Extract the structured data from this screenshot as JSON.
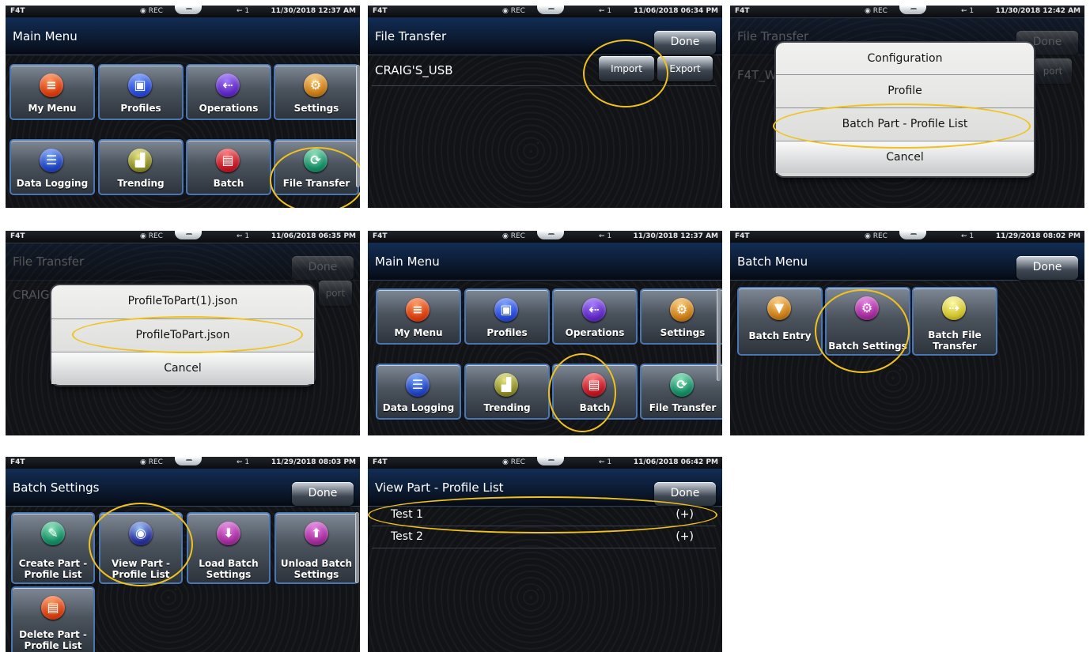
{
  "panels": [
    {
      "status": {
        "app": "F4T",
        "rec": "REC",
        "usb": "1",
        "datetime": "11/30/2018 12:37 AM"
      },
      "title": "Main Menu",
      "tiles": [
        {
          "label": "My Menu",
          "icon": "menu-icon",
          "glyph": "≡"
        },
        {
          "label": "Profiles",
          "icon": "profiles-icon",
          "glyph": "▣"
        },
        {
          "label": "Operations",
          "icon": "operations-icon",
          "glyph": "⇠"
        },
        {
          "label": "Settings",
          "icon": "settings-icon",
          "glyph": "⚙"
        },
        {
          "label": "Data Logging",
          "icon": "database-icon",
          "glyph": "☰"
        },
        {
          "label": "Trending",
          "icon": "trending-icon",
          "glyph": "▟"
        },
        {
          "label": "Batch",
          "icon": "batch-icon",
          "glyph": "▤"
        },
        {
          "label": "File Transfer",
          "icon": "file-transfer-icon",
          "glyph": "⟳"
        }
      ]
    },
    {
      "status": {
        "app": "F4T",
        "rec": "REC",
        "usb": "1",
        "datetime": "11/06/2018 06:34 PM"
      },
      "title": "File Transfer",
      "done": "Done",
      "device": "CRAIG'S_USB",
      "import": "Import",
      "export": "Export"
    },
    {
      "status": {
        "app": "F4T",
        "rec": "REC",
        "usb": "1",
        "datetime": "11/30/2018 12:42 AM"
      },
      "background_title": "File Transfer",
      "background_done": "Done",
      "background_device": "F4T_W",
      "background_export": "port",
      "dialog": [
        "Configuration",
        "Profile",
        "Batch Part - Profile List",
        "Cancel"
      ]
    },
    {
      "status": {
        "app": "F4T",
        "rec": "REC",
        "usb": "1",
        "datetime": "11/06/2018 06:35 PM"
      },
      "background_title": "File Transfer",
      "background_done": "Done",
      "background_device": "CRAIG",
      "background_export": "port",
      "dialog": [
        "ProfileToPart(1).json",
        "ProfileToPart.json",
        "Cancel"
      ]
    },
    {
      "status": {
        "app": "F4T",
        "rec": "REC",
        "usb": "1",
        "datetime": "11/30/2018 12:37 AM"
      },
      "title": "Main Menu",
      "tiles": [
        {
          "label": "My Menu",
          "icon": "menu-icon",
          "glyph": "≡"
        },
        {
          "label": "Profiles",
          "icon": "profiles-icon",
          "glyph": "▣"
        },
        {
          "label": "Operations",
          "icon": "operations-icon",
          "glyph": "⇠"
        },
        {
          "label": "Settings",
          "icon": "settings-icon",
          "glyph": "⚙"
        },
        {
          "label": "Data Logging",
          "icon": "database-icon",
          "glyph": "☰"
        },
        {
          "label": "Trending",
          "icon": "trending-icon",
          "glyph": "▟"
        },
        {
          "label": "Batch",
          "icon": "batch-icon",
          "glyph": "▤"
        },
        {
          "label": "File Transfer",
          "icon": "file-transfer-icon",
          "glyph": "⟳"
        }
      ]
    },
    {
      "status": {
        "app": "F4T",
        "rec": "REC",
        "usb": "1",
        "datetime": "11/29/2018 08:02 PM"
      },
      "title": "Batch Menu",
      "done": "Done",
      "tiles": [
        {
          "label": "Batch Entry",
          "icon": "batch-entry-icon",
          "glyph": "▼"
        },
        {
          "label": "Batch Settings",
          "icon": "batch-settings-icon",
          "glyph": "⚙"
        },
        {
          "label": "Batch File Transfer",
          "icon": "batch-file-transfer-icon",
          "glyph": "⇢"
        }
      ]
    },
    {
      "status": {
        "app": "F4T",
        "rec": "REC",
        "usb": "1",
        "datetime": "11/29/2018 08:03 PM"
      },
      "title": "Batch Settings",
      "done": "Done",
      "tiles": [
        {
          "label": "Create Part - Profile List",
          "icon": "create-part-list-icon",
          "glyph": "✎"
        },
        {
          "label": "View Part - Profile List",
          "icon": "view-part-list-icon",
          "glyph": "◉"
        },
        {
          "label": "Load Batch Settings",
          "icon": "load-batch-settings-icon",
          "glyph": "⬇"
        },
        {
          "label": "Unload Batch Settings",
          "icon": "unload-batch-settings-icon",
          "glyph": "⬆"
        },
        {
          "label": "Delete Part - Profile List",
          "icon": "delete-part-list-icon",
          "glyph": "▤"
        }
      ]
    },
    {
      "status": {
        "app": "F4T",
        "rec": "REC",
        "usb": "1",
        "datetime": "11/06/2018 06:42 PM"
      },
      "title": "View Part - Profile List",
      "done": "Done",
      "rows": [
        {
          "label": "Test 1",
          "value": "(+)"
        },
        {
          "label": "Test 2",
          "value": "(+)"
        }
      ]
    }
  ]
}
